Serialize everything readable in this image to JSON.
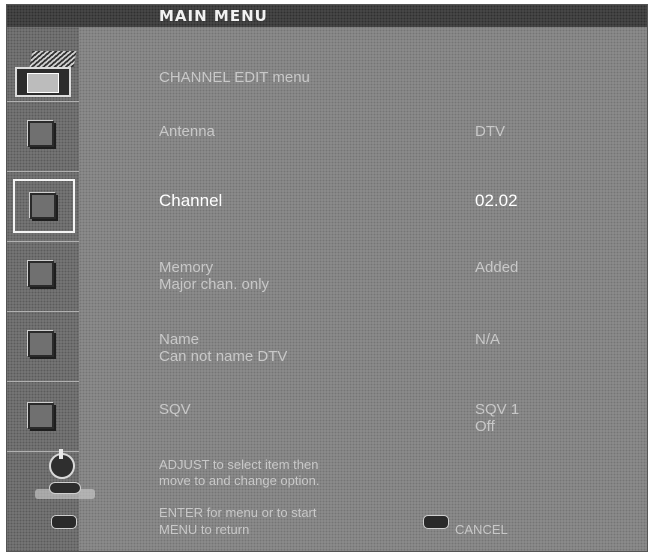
{
  "title": "MAIN MENU",
  "menu": {
    "header": "CHANNEL EDIT menu",
    "items": [
      {
        "label": "Antenna",
        "value": "DTV"
      },
      {
        "label": "Channel",
        "value": "02.02",
        "selected": true
      },
      {
        "label": "Memory",
        "sublabel": "Major chan. only",
        "value": "Added"
      },
      {
        "label": "Name",
        "sublabel": "Can not name DTV",
        "value": "N/A"
      },
      {
        "label": "SQV",
        "value": "SQV 1",
        "value2": "Off"
      }
    ]
  },
  "hints": {
    "adjust_line1": "ADJUST to select item then",
    "adjust_line2": "move to and change option.",
    "enter_line": "ENTER for menu or to start",
    "menu_line": "MENU to return",
    "cancel_label": "CANCEL"
  },
  "icons": {
    "top_tab": "channel-edit-tab-icon",
    "tabs": [
      "antenna-tab-icon",
      "channel-tab-icon",
      "memory-tab-icon",
      "name-tab-icon",
      "sqv-tab-icon"
    ],
    "adjust": "adjust-knob-icon",
    "enter": "enter-button-icon",
    "menu": "menu-button-icon",
    "cancel": "cancel-button-icon"
  }
}
